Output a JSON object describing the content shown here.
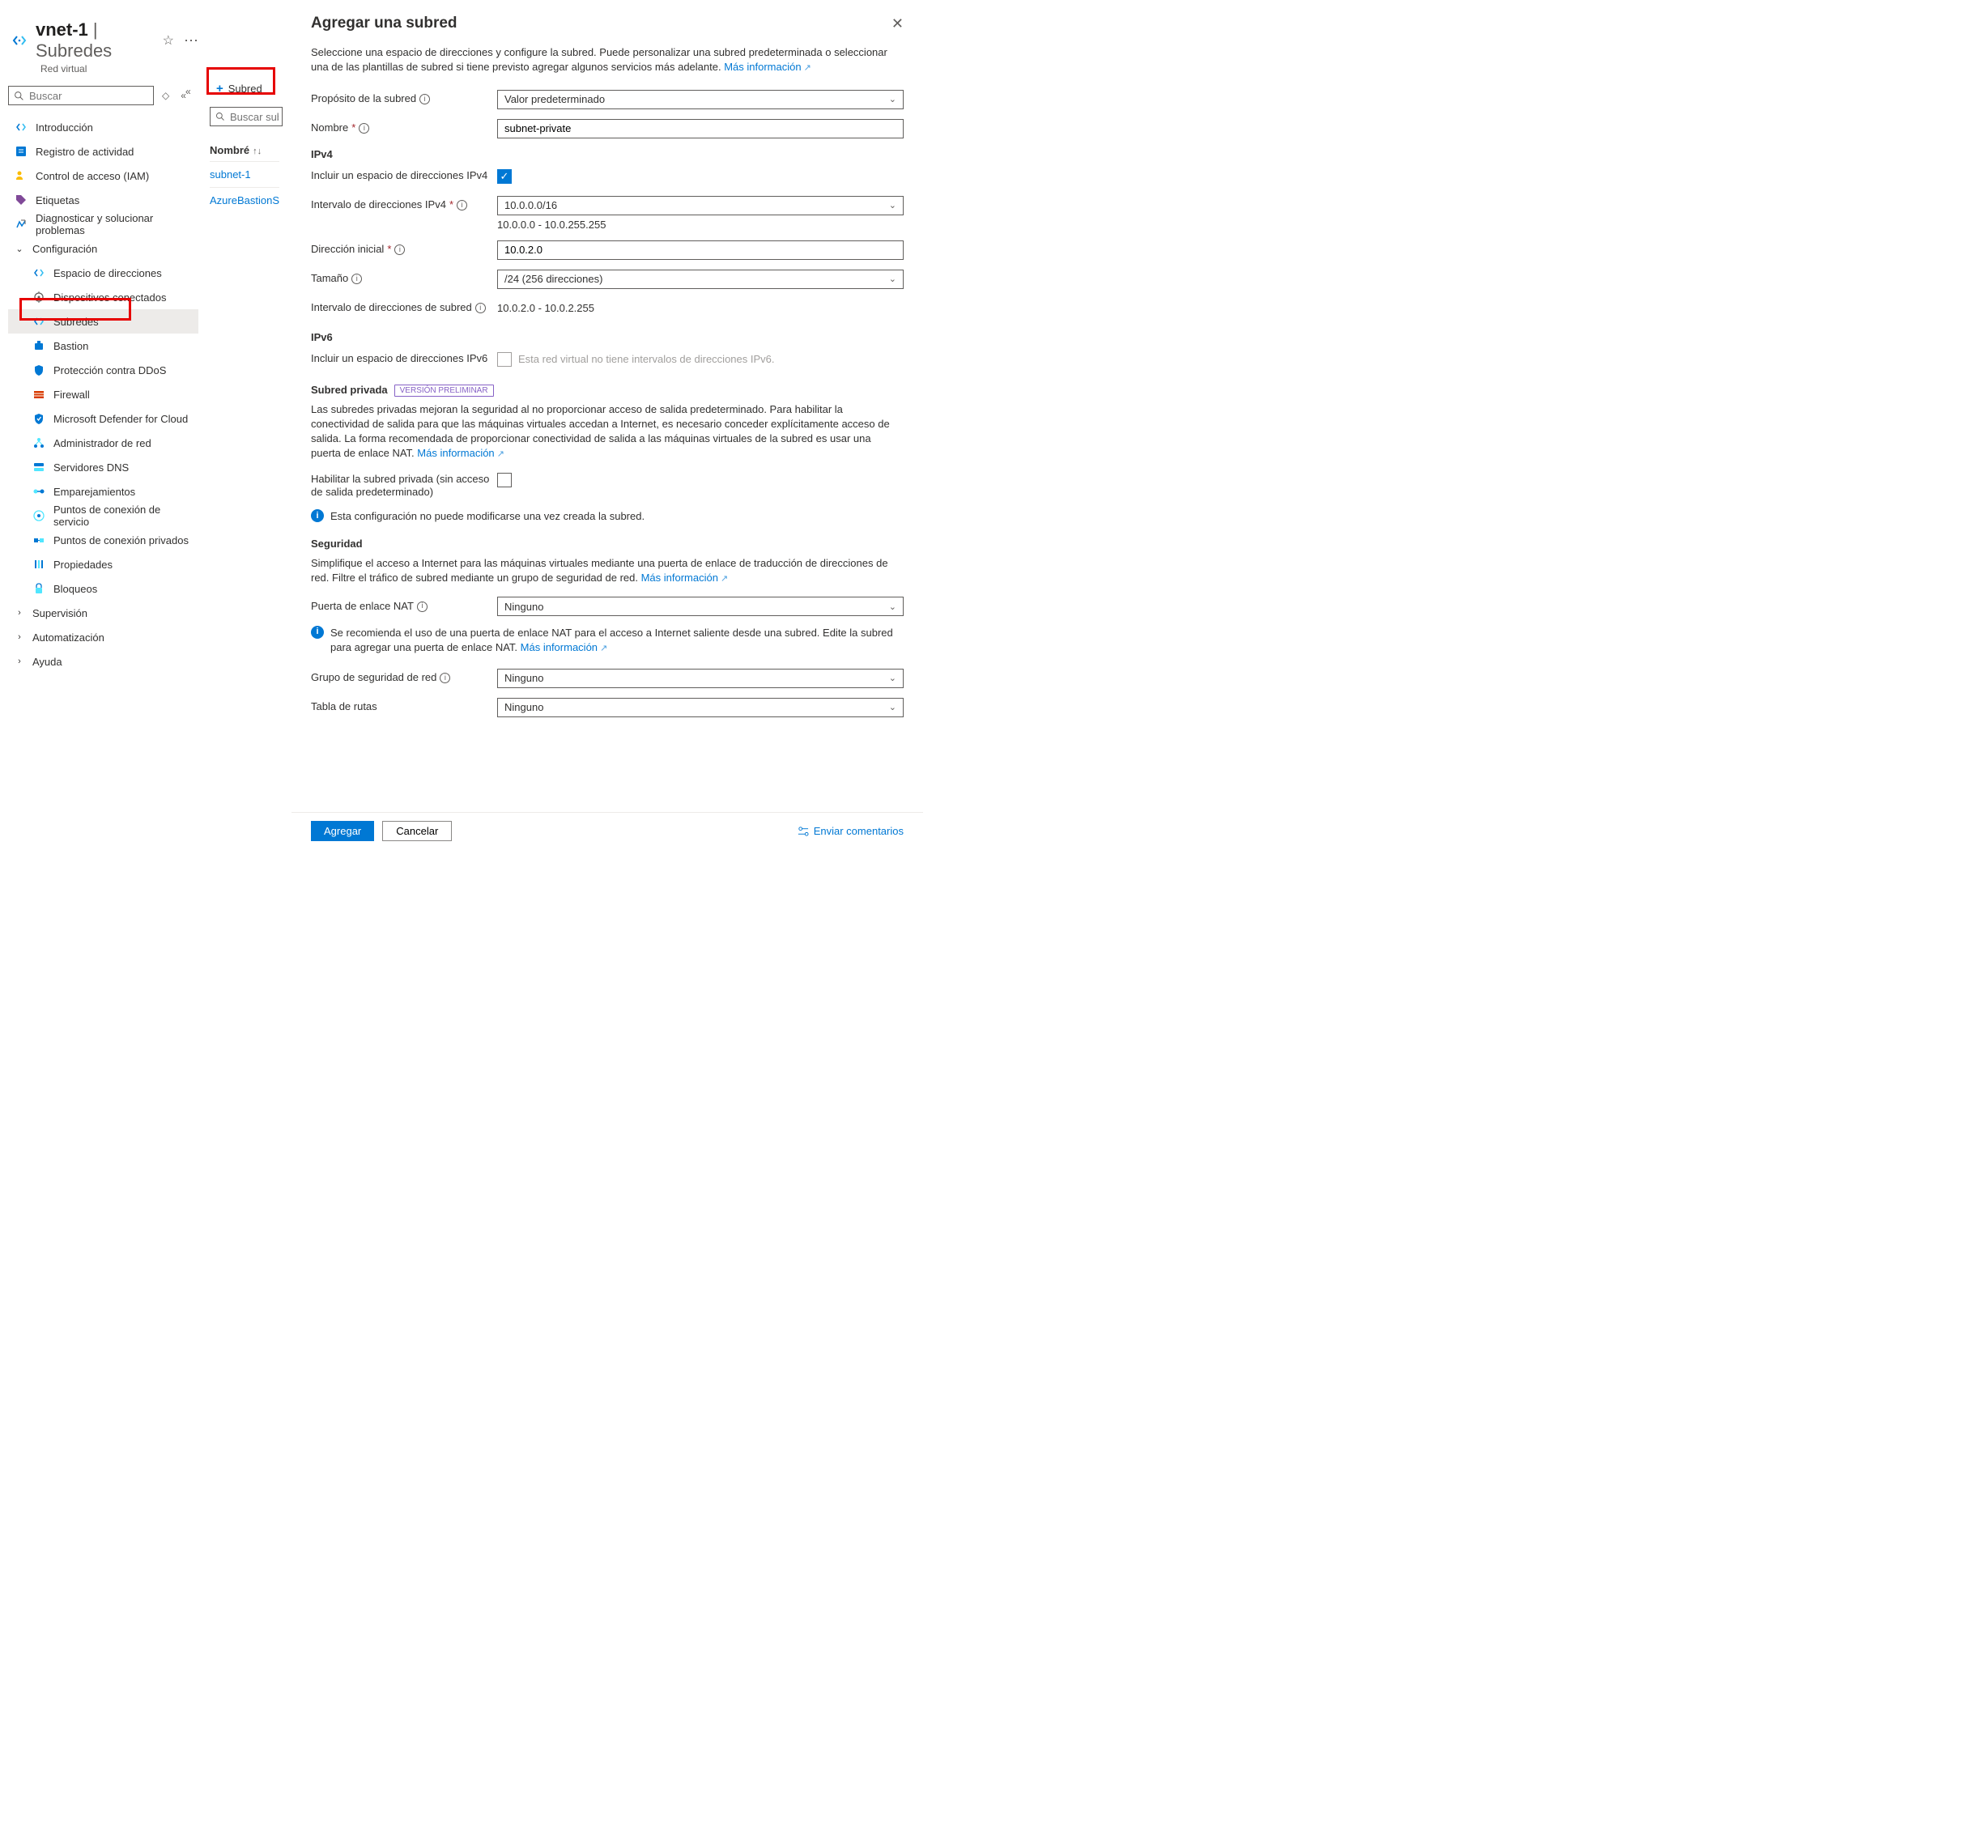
{
  "header": {
    "title_main": "vnet-1",
    "title_sep": "|",
    "title_sub": "Subredes",
    "subtitle": "Red virtual"
  },
  "sidebar": {
    "search_placeholder": "Buscar",
    "items": [
      {
        "label": "Introducción",
        "icon": "vnet"
      },
      {
        "label": "Registro de actividad",
        "icon": "log"
      },
      {
        "label": "Control de acceso (IAM)",
        "icon": "iam"
      },
      {
        "label": "Etiquetas",
        "icon": "tag"
      },
      {
        "label": "Diagnosticar y solucionar problemas",
        "icon": "diag"
      }
    ],
    "config_label": "Configuración",
    "config_items": [
      {
        "label": "Espacio de direcciones",
        "icon": "addr"
      },
      {
        "label": "Dispositivos conectados",
        "icon": "conn"
      },
      {
        "label": "Subredes",
        "icon": "subnet",
        "selected": true
      },
      {
        "label": "Bastion",
        "icon": "bastion"
      },
      {
        "label": "Protección contra DDoS",
        "icon": "ddos"
      },
      {
        "label": "Firewall",
        "icon": "fw"
      },
      {
        "label": "Microsoft Defender for Cloud",
        "icon": "def"
      },
      {
        "label": "Administrador de red",
        "icon": "netmgr"
      },
      {
        "label": "Servidores DNS",
        "icon": "dns"
      },
      {
        "label": "Emparejamientos",
        "icon": "peer"
      },
      {
        "label": "Puntos de conexión de servicio",
        "icon": "svcep"
      },
      {
        "label": "Puntos de conexión privados",
        "icon": "pvtep"
      },
      {
        "label": "Propiedades",
        "icon": "props"
      },
      {
        "label": "Bloqueos",
        "icon": "lock"
      }
    ],
    "groups": [
      {
        "label": "Supervisión"
      },
      {
        "label": "Automatización"
      },
      {
        "label": "Ayuda"
      }
    ]
  },
  "toolbar": {
    "add_subnet": "Subred",
    "mid_search_placeholder": "Buscar subr"
  },
  "table": {
    "header": "Nombré",
    "rows": [
      "subnet-1",
      "AzureBastionS"
    ]
  },
  "panel": {
    "title": "Agregar una subred",
    "intro": "Seleccione una espacio de direcciones y configure la subred. Puede personalizar una subred predeterminada o seleccionar una de las plantillas de subred si tiene previsto agregar algunos servicios más adelante.",
    "learn_more": "Más información",
    "purpose_label": "Propósito de la subred",
    "purpose_value": "Valor predeterminado",
    "name_label": "Nombre",
    "name_value": "subnet-private",
    "ipv4_heading": "IPv4",
    "ipv4_include_label": "Incluir un espacio de direcciones IPv4",
    "ipv4_range_label": "Intervalo de direcciones IPv4",
    "ipv4_range_value": "10.0.0.0/16",
    "ipv4_range_under": "10.0.0.0 - 10.0.255.255",
    "start_label": "Dirección inicial",
    "start_value": "10.0.2.0",
    "size_label": "Tamaño",
    "size_value": "/24 (256 direcciones)",
    "subnet_range_label": "Intervalo de direcciones de subred",
    "subnet_range_value": "10.0.2.0 - 10.0.2.255",
    "ipv6_heading": "IPv6",
    "ipv6_include_label": "Incluir un espacio de direcciones IPv6",
    "ipv6_disabled_text": "Esta red virtual no tiene intervalos de direcciones IPv6.",
    "private_heading": "Subred privada",
    "private_badge": "VERSIÓN PRELIMINAR",
    "private_desc": "Las subredes privadas mejoran la seguridad al no proporcionar acceso de salida predeterminado. Para habilitar la conectividad de salida para que las máquinas virtuales accedan a Internet, es necesario conceder explícitamente acceso de salida. La forma recomendada de proporcionar conectividad de salida a las máquinas virtuales de la subred es usar una puerta de enlace NAT.",
    "private_enable_label": "Habilitar la subred privada (sin acceso de salida predeterminado)",
    "private_warning": "Esta configuración no puede modificarse una vez creada la subred.",
    "security_heading": "Seguridad",
    "security_desc": "Simplifique el acceso a Internet para las máquinas virtuales mediante una puerta de enlace de traducción de direcciones de red. Filtre el tráfico de subred mediante un grupo de seguridad de red.",
    "nat_label": "Puerta de enlace NAT",
    "nat_value": "Ninguno",
    "nat_info": "Se recomienda el uso de una puerta de enlace NAT para el acceso a Internet saliente desde una subred. Edite la subred para agregar una puerta de enlace NAT.",
    "nsg_label": "Grupo de seguridad de red",
    "nsg_value": "Ninguno",
    "route_label": "Tabla de rutas",
    "route_value": "Ninguno",
    "footer_add": "Agregar",
    "footer_cancel": "Cancelar",
    "footer_feedback": "Enviar comentarios"
  }
}
